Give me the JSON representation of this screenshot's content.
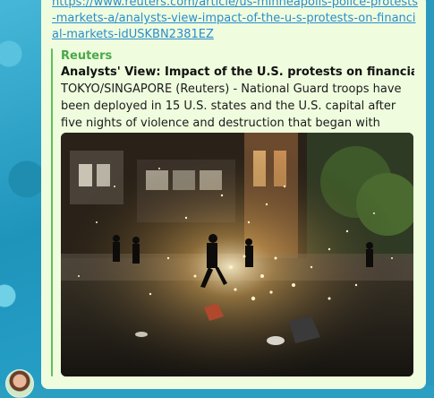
{
  "message": {
    "link_text": "https://www.reuters.com/article/us-minneapolis-police-protests-markets-a/analysts-view-impact-of-the-u-s-protests-on-financial-markets-idUSKBN2381EZ",
    "preview": {
      "site_name": "Reuters",
      "title": "Analysts' View: Impact of the U.S. protests on financial markets",
      "description": "TOKYO/SINGAPORE (Reuters) - National Guard troops have been deployed in 15 U.S. states and the U.S. capital after five nights of violence and destruction that began with peaceful protests over ..."
    }
  },
  "colors": {
    "bubble": "#effdde",
    "link": "#2a8ccf",
    "site_name": "#4aa84a",
    "accent_bar": "#5fbf5a"
  },
  "icons": {
    "avatar": "avatar-icon"
  }
}
